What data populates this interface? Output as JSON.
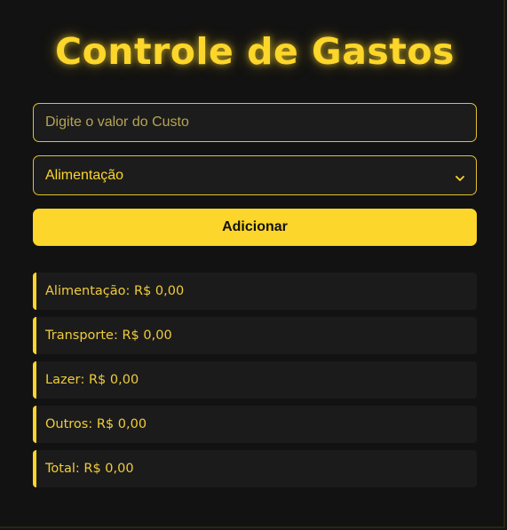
{
  "title": "Controle de Gastos",
  "cost_input": {
    "placeholder": "Digite o valor do Custo",
    "value": ""
  },
  "category_select": {
    "selected": "Alimentação",
    "icon": "chevron-down-icon"
  },
  "add_button": {
    "label": "Adicionar"
  },
  "totals": [
    {
      "label": "Alimentação",
      "value": "R$ 0,00"
    },
    {
      "label": "Transporte",
      "value": "R$ 0,00"
    },
    {
      "label": "Lazer",
      "value": "R$ 0,00"
    },
    {
      "label": "Outros",
      "value": "R$ 0,00"
    },
    {
      "label": "Total",
      "value": "R$ 0,00"
    }
  ],
  "colors": {
    "accent": "#fcd62a",
    "background": "#121212",
    "row_background": "#1b1b1b"
  }
}
